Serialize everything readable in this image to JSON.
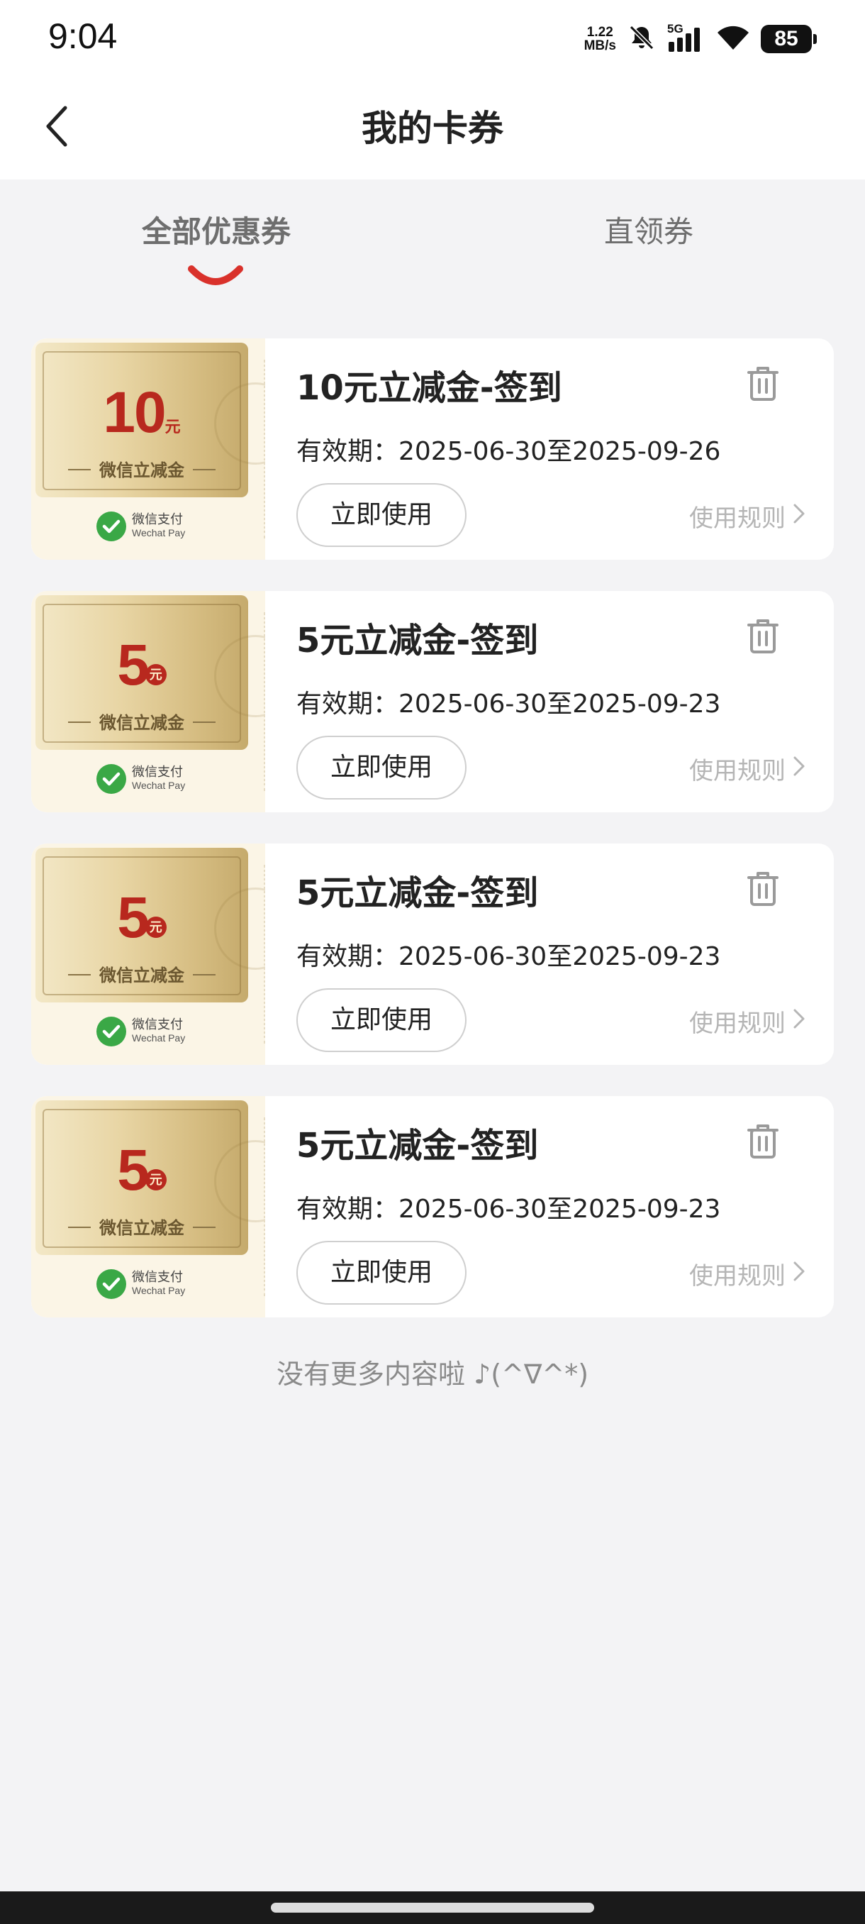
{
  "status_bar": {
    "time": "9:04",
    "net_speed_value": "1.22",
    "net_speed_unit": "MB/s",
    "network": "5G",
    "battery": "85",
    "icons": [
      "mute-icon",
      "signal-icon",
      "wifi-icon",
      "battery-icon"
    ]
  },
  "header": {
    "title": "我的卡券",
    "back_icon": "chevron-left-icon"
  },
  "tabs": [
    {
      "label": "全部优惠券",
      "active": true
    },
    {
      "label": "直领券",
      "active": false
    }
  ],
  "coupons": [
    {
      "ticket_amount": "10",
      "ticket_unit": "元",
      "ticket_type": "微信立减金",
      "pay_cn": "微信支付",
      "pay_en": "Wechat Pay",
      "title": "10元立减金-签到",
      "validity": "有效期：2025-06-30至2025-09-26",
      "use_label": "立即使用",
      "rules_label": "使用规则"
    },
    {
      "ticket_amount": "5",
      "ticket_unit": "元",
      "ticket_type": "微信立减金",
      "pay_cn": "微信支付",
      "pay_en": "Wechat Pay",
      "title": "5元立减金-签到",
      "validity": "有效期：2025-06-30至2025-09-23",
      "use_label": "立即使用",
      "rules_label": "使用规则"
    },
    {
      "ticket_amount": "5",
      "ticket_unit": "元",
      "ticket_type": "微信立减金",
      "pay_cn": "微信支付",
      "pay_en": "Wechat Pay",
      "title": "5元立减金-签到",
      "validity": "有效期：2025-06-30至2025-09-23",
      "use_label": "立即使用",
      "rules_label": "使用规则"
    },
    {
      "ticket_amount": "5",
      "ticket_unit": "元",
      "ticket_type": "微信立减金",
      "pay_cn": "微信支付",
      "pay_en": "Wechat Pay",
      "title": "5元立减金-签到",
      "validity": "有效期：2025-06-30至2025-09-23",
      "use_label": "立即使用",
      "rules_label": "使用规则"
    }
  ],
  "footer": {
    "no_more_text": "没有更多内容啦 ♪(^∇^*)"
  },
  "colors": {
    "accent_red": "#d9312b",
    "amount_red": "#b8281e",
    "wechat_green": "#3aa846",
    "background": "#f3f3f5"
  }
}
